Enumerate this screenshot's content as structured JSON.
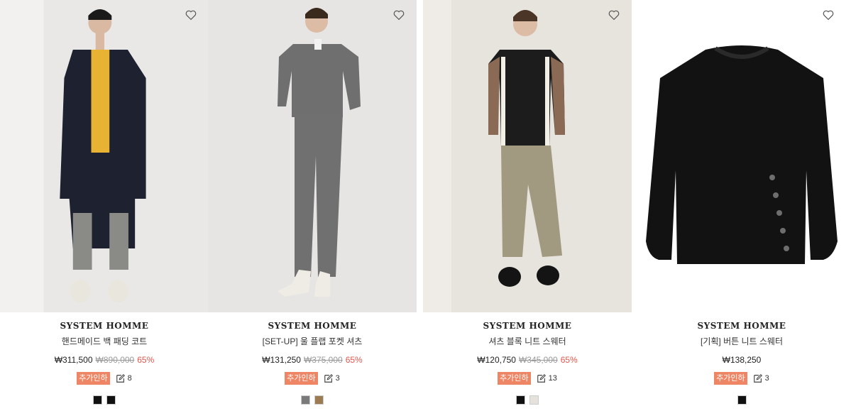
{
  "products": [
    {
      "brand": "SYSTEM HOMME",
      "name": "핸드메이드 백 패딩 코트",
      "price": "₩311,500",
      "original_price": "₩890,000",
      "discount": "65%",
      "badge": "추가인하",
      "review_count": "8",
      "swatches": [
        "#111111",
        "#111111"
      ]
    },
    {
      "brand": "SYSTEM HOMME",
      "name": "[SET-UP] 울 플랩 포켓 셔츠",
      "price": "₩131,250",
      "original_price": "₩375,000",
      "discount": "65%",
      "badge": "추가인하",
      "review_count": "3",
      "swatches": [
        "#7a7a7a",
        "#9c7a52"
      ]
    },
    {
      "brand": "SYSTEM HOMME",
      "name": "셔츠 블록 니트 스웨터",
      "price": "₩120,750",
      "original_price": "₩345,000",
      "discount": "65%",
      "badge": "추가인하",
      "review_count": "13",
      "swatches": [
        "#111111",
        "#e4e2da"
      ]
    },
    {
      "brand": "SYSTEM HOMME",
      "name": "[기획] 버튼 니트 스웨터",
      "price": "₩138,250",
      "original_price": "",
      "discount": "",
      "badge": "추가인하",
      "review_count": "3",
      "swatches": [
        "#111111"
      ]
    }
  ],
  "icons": {
    "wishlist": "heart-icon",
    "review": "edit-icon"
  },
  "colors": {
    "badge": "#ee8665",
    "discount": "#e5554b"
  }
}
